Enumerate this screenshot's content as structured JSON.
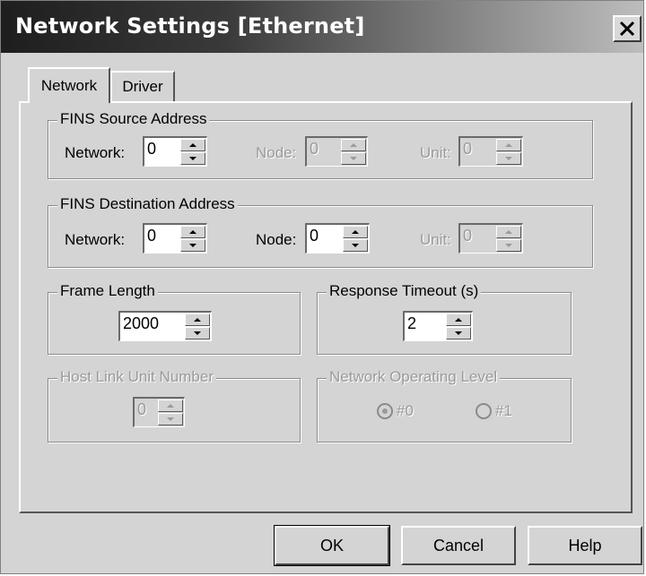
{
  "window": {
    "title": "Network Settings [Ethernet]"
  },
  "tabs": [
    {
      "label": "Network",
      "active": true
    },
    {
      "label": "Driver",
      "active": false
    }
  ],
  "fins_source": {
    "legend": "FINS Source Address",
    "network_label": "Network:",
    "network_value": "0",
    "node_label": "Node:",
    "node_value": "0",
    "unit_label": "Unit:",
    "unit_value": "0"
  },
  "fins_destination": {
    "legend": "FINS Destination Address",
    "network_label": "Network:",
    "network_value": "0",
    "node_label": "Node:",
    "node_value": "0",
    "unit_label": "Unit:",
    "unit_value": "0"
  },
  "frame_length": {
    "legend": "Frame Length",
    "value": "2000"
  },
  "response_timeout": {
    "legend": "Response Timeout (s)",
    "value": "2"
  },
  "host_link": {
    "legend": "Host Link Unit Number",
    "value": "0"
  },
  "operating_level": {
    "legend": "Network Operating Level",
    "options": [
      {
        "label": "#0",
        "selected": true
      },
      {
        "label": "#1",
        "selected": false
      }
    ]
  },
  "buttons": {
    "ok": "OK",
    "cancel": "Cancel",
    "help": "Help"
  },
  "icons": {
    "close": "close-icon",
    "spin_up": "spin-up-icon",
    "spin_down": "spin-down-icon"
  }
}
